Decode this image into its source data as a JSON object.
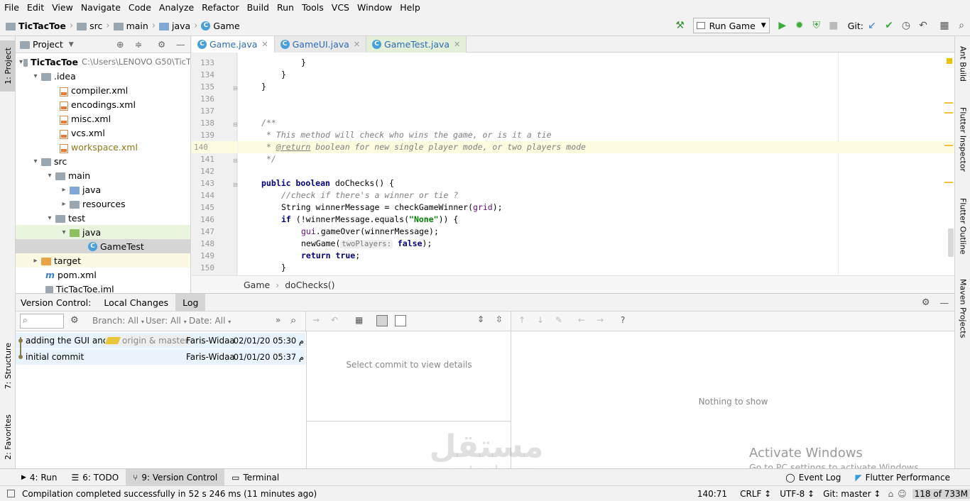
{
  "menu": [
    "File",
    "Edit",
    "View",
    "Navigate",
    "Code",
    "Analyze",
    "Refactor",
    "Build",
    "Run",
    "Tools",
    "VCS",
    "Window",
    "Help"
  ],
  "breadcrumb": [
    "TicTacToe",
    "src",
    "main",
    "java",
    "Game"
  ],
  "toolbar": {
    "run_config": "Run Game",
    "git_label": "Git:"
  },
  "left_tabs": {
    "project": "1: Project",
    "structure": "7: Structure",
    "favorites": "2: Favorites"
  },
  "right_tabs": {
    "ant": "Ant Build",
    "flutter_inspector": "Flutter Inspector",
    "flutter_outline": "Flutter Outline",
    "maven": "Maven Projects"
  },
  "project": {
    "title": "Project",
    "tree": [
      {
        "label": "TicTacToe",
        "extra": "C:\\Users\\LENOVO G50\\TicT"
      },
      {
        "label": ".idea"
      },
      {
        "label": "compiler.xml"
      },
      {
        "label": "encodings.xml"
      },
      {
        "label": "misc.xml"
      },
      {
        "label": "vcs.xml"
      },
      {
        "label": "workspace.xml"
      },
      {
        "label": "src"
      },
      {
        "label": "main"
      },
      {
        "label": "java"
      },
      {
        "label": "resources"
      },
      {
        "label": "test"
      },
      {
        "label": "java"
      },
      {
        "label": "GameTest"
      },
      {
        "label": "target"
      },
      {
        "label": "pom.xml"
      },
      {
        "label": "TicTacToe.iml"
      }
    ]
  },
  "editor": {
    "tabs": [
      "Game.java",
      "GameUI.java",
      "GameTest.java"
    ],
    "line_numbers": [
      "133",
      "134",
      "135",
      "136",
      "137",
      "138",
      "139",
      "140",
      "141",
      "142",
      "143",
      "144",
      "145",
      "146",
      "147",
      "148",
      "149",
      "150"
    ],
    "code": {
      "l133": "}",
      "l134": "}",
      "l135": "}",
      "l138": "/**",
      "l139": " * This method will check who wins the game, or is it a tie",
      "l140_tag": "@return",
      "l140_rest": " boolean for new single player mode, or two players mode",
      "l141": " */",
      "l143_kw1": "public",
      "l143_kw2": "boolean",
      "l143_rest": " doChecks() {",
      "l144": "//check if there's a winner or tie ?",
      "l145_a": "String winnerMessage = checkGameWinner(",
      "l145_b": "grid",
      "l145_c": ");",
      "l146_kw": "if",
      "l146_a": " (!winnerMessage.equals(",
      "l146_str": "\"None\"",
      "l146_b": ")) {",
      "l147_a": "gui",
      "l147_b": ".gameOver(winnerMessage);",
      "l148_a": "newGame(",
      "l148_hint": "twoPlayers:",
      "l148_kw": "false",
      "l148_b": ");",
      "l149_kw1": "return",
      "l149_kw2": "true",
      "l149_b": ";",
      "l150": "}"
    },
    "breadcrumb": [
      "Game",
      "doChecks()"
    ]
  },
  "vc": {
    "label": "Version Control:",
    "tabs": [
      "Local Changes",
      "Log"
    ],
    "filter": {
      "branch": "Branch: All",
      "user": "User: All",
      "date": "Date: All"
    },
    "commits": [
      {
        "message": "adding the GUI and t",
        "refs": "origin & master",
        "author": "Faris-Widaa",
        "time": "م 05:30 02/01/20"
      },
      {
        "message": "initial commit",
        "author": "Faris-Widaa",
        "time": "م 05:37 01/01/20"
      }
    ],
    "details_placeholder": "Select commit to view details",
    "empty": "Nothing to show"
  },
  "bottom_tabs": [
    "4: Run",
    "6: TODO",
    "9: Version Control",
    "Terminal",
    "Event Log",
    "Flutter Performance"
  ],
  "status": {
    "message": "Compilation completed successfully in 52 s 246 ms (11 minutes ago)",
    "position": "140:71",
    "line_sep": "CRLF ↕",
    "encoding": "UTF-8 ↕",
    "git": "Git: master ↕",
    "memory": "118 of 733M"
  },
  "watermark": {
    "title": "Activate Windows",
    "subtitle": "Go to PC settings to activate Windows."
  },
  "overlay": {
    "arabic": "مستقل",
    "latin": "mostaql.com"
  }
}
